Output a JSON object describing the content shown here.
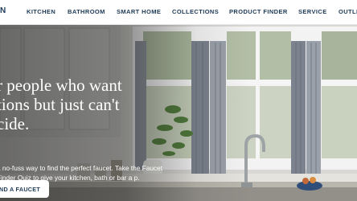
{
  "nav": {
    "logo_fragment": "N",
    "items": [
      "KITCHEN",
      "BATHROOM",
      "SMART HOME",
      "COLLECTIONS",
      "PRODUCT FINDER",
      "SERVICE",
      "OUTLE"
    ]
  },
  "hero": {
    "headline": "r people who want tions but just can't cide.",
    "body": "a no-fuss way to find the perfect faucet. Take the Faucet Finder Quiz to give your kitchen, bath or bar a p.",
    "cta_label": "ND A FAUCET"
  },
  "colors": {
    "brand_navy": "#1d3a57",
    "hero_text": "#ffffff"
  }
}
